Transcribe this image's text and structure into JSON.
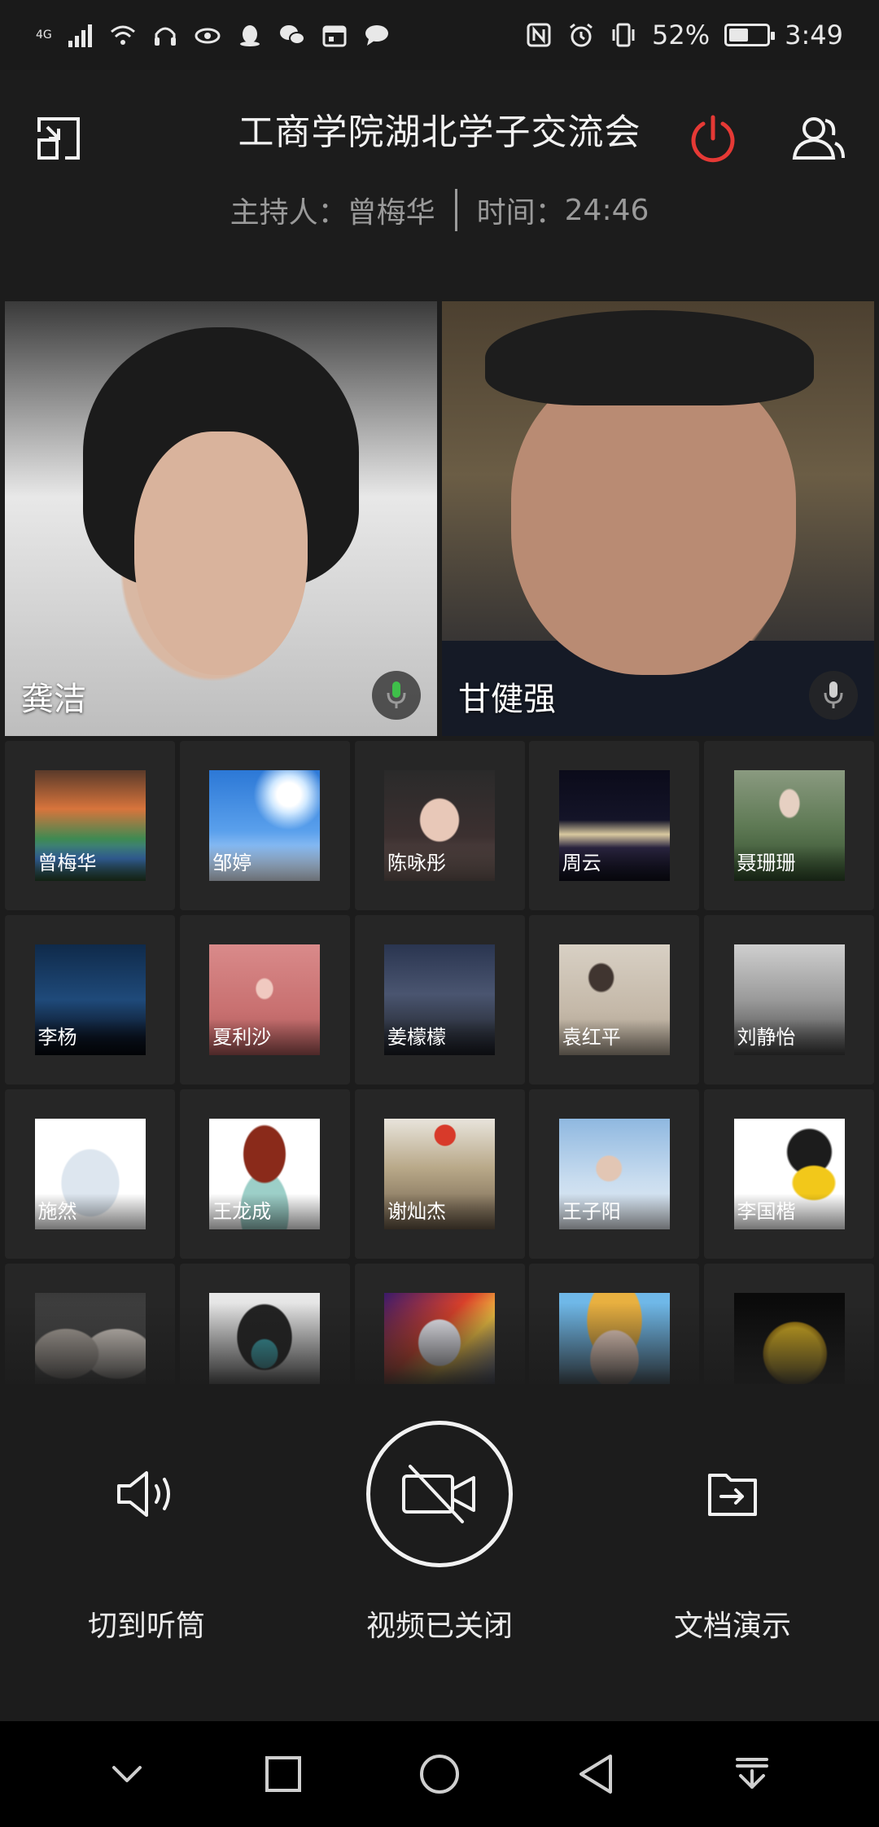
{
  "status_bar": {
    "network": "4G",
    "battery_percent": "52%",
    "battery_level": 0.52,
    "time": "3:49"
  },
  "header": {
    "title": "工商学院湖北学子交流会",
    "host_label": "主持人：",
    "host_name": "曾梅华",
    "time_label": "时间：",
    "elapsed": "24:46",
    "power_color": "#e53935"
  },
  "videos": [
    {
      "name": "龚洁"
    },
    {
      "name": "甘健强"
    }
  ],
  "participants": [
    {
      "name": "曾梅华",
      "bg": "linear-gradient(180deg,#5a3a2a 0%,#d8743c 35%,#3f8a52 62%,#3a6fb0 80%,#2a4a2a 100%)"
    },
    {
      "name": "邹婷",
      "bg": "radial-gradient(circle at 72% 22%,#ffffff 0 10%,#cfe8ff 16%,transparent 30%),linear-gradient(180deg,#2c78d6 0%,#5aa0ec 55%,#e8f2ff 100%)"
    },
    {
      "name": "陈咏彤",
      "bg": "radial-gradient(ellipse at 50% 45%,#e8c8b8 0 24%,transparent 26%),linear-gradient(180deg,#2a2a2a 0%,#3c3030 60%,#6a5a55 100%)"
    },
    {
      "name": "周云",
      "bg": "linear-gradient(180deg,#0b0b1a 0%,#141428 45%,#d9c9a0 58%,#2a2440 70%,#0e0e1a 100%)"
    },
    {
      "name": "聂珊珊",
      "bg": "radial-gradient(ellipse at 50% 30%,#e6d0c2 0 12%,transparent 14%),linear-gradient(180deg,#8a9a80 0%,#5f7a55 50%,#2f4a2a 100%)"
    },
    {
      "name": "李杨",
      "bg": "linear-gradient(180deg,#0f2a4a 0%,#1f4a7a 50%,#0a1220 85%,#05080e 100%)"
    },
    {
      "name": "夏利沙",
      "bg": "radial-gradient(ellipse at 50% 40%,#f0c9c0 0 10%,transparent 12%),linear-gradient(180deg,#d98a8a 0%,#c87070 60%,#a85858 100%)"
    },
    {
      "name": "姜檬檬",
      "bg": "linear-gradient(180deg,#2a3550 0%,#4a5570 45%,#2a2f3a 80%,#1a1c24 100%)"
    },
    {
      "name": "袁红平",
      "bg": "radial-gradient(ellipse at 38% 30%,#403530 0 12%,transparent 14%),linear-gradient(180deg,#d8d0c4 0%,#c4b8a8 60%,#a89c8c 100%)"
    },
    {
      "name": "刘静怡",
      "bg": "linear-gradient(180deg,#cfcfcf 0%,#9a9a9a 50%,#404040 100%)"
    },
    {
      "name": "施然",
      "bg": "radial-gradient(ellipse at 50% 58%,#dde6ef 0 36%,transparent 38%),linear-gradient(180deg,#ffffff 0%,#ffffff 100%)"
    },
    {
      "name": "王龙成",
      "bg": "radial-gradient(ellipse at 50% 32%,#8a2a1a 0 26%,transparent 28%),radial-gradient(ellipse at 50% 85%,#9ccfc8 0 30%,transparent 32%),linear-gradient(180deg,#ffffff 0%,#ffffff 100%)"
    },
    {
      "name": "谢灿杰",
      "bg": "radial-gradient(circle at 55% 15%,#d83a2a 0 9%,transparent 10%),linear-gradient(180deg,#e8e4dc 0%,#b8a888 45%,#6a5a48 100%)"
    },
    {
      "name": "王子阳",
      "bg": "radial-gradient(ellipse at 45% 45%,#e2c6b4 0 14%,transparent 16%),linear-gradient(180deg,#8fb8e0 0%,#c8dcef 55%,#e8eef4 100%)"
    },
    {
      "name": "李国楷",
      "bg": "radial-gradient(ellipse at 72% 58%,#f2c81a 0 18%,transparent 20%),radial-gradient(ellipse at 68% 30%,#1c1c1c 0 20%,transparent 22%),linear-gradient(180deg,#ffffff 0%,#ffffff 100%)"
    },
    {
      "name": "",
      "bg": "radial-gradient(ellipse at 28% 55%,#b0a8a0 0 28%,transparent 30%),radial-gradient(ellipse at 75% 55%,#d8d0c8 0 28%,transparent 30%),linear-gradient(180deg,#3a3a3a 0%,#5a5a5a 100%)"
    },
    {
      "name": "",
      "bg": "radial-gradient(ellipse at 50% 55%,#3aa6b0 0 16%,transparent 18%),radial-gradient(ellipse at 50% 40%,#222 0 34%,transparent 36%),linear-gradient(180deg,#e8e8e8 0%,#cfcfcf 100%)"
    },
    {
      "name": "",
      "bg": "radial-gradient(ellipse at 50% 45%,#f0f0f8 0 26%,transparent 28%),linear-gradient(135deg,#3a1a6a 0%,#d8402a 40%,#f0c040 60%,#2a4ab0 100%)"
    },
    {
      "name": "",
      "bg": "radial-gradient(ellipse at 50% 60%,#f5d8c8 0 30%,transparent 32%),radial-gradient(ellipse at 50% 25%,#e8b040 0 34%,transparent 36%),linear-gradient(180deg,#6fb8e8 0%,#6fb8e8 100%)"
    },
    {
      "name": "",
      "bg": "radial-gradient(circle at 55% 55%,#d8b020 0 30%,#a07a10 36%,transparent 38%),linear-gradient(180deg,#0a0a0a 0%,#141414 100%)"
    }
  ],
  "controls": {
    "speaker_label": "切到听筒",
    "video_label": "视频已关闭",
    "doc_label": "文档演示"
  },
  "icons": {
    "exit_fullscreen": "shrink-window-icon",
    "power": "power-icon",
    "participants": "participants-icon",
    "speaker": "speaker-icon",
    "video_off": "video-off-icon",
    "document": "document-share-icon"
  }
}
